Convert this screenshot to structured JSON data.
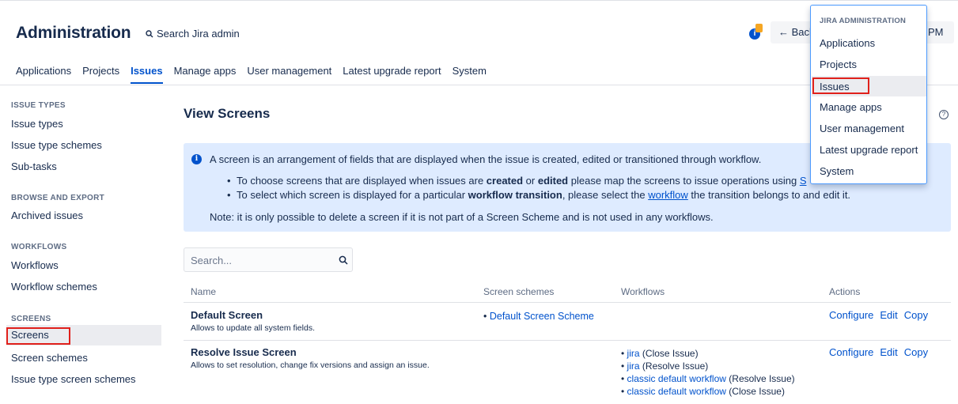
{
  "header": {
    "title": "Administration",
    "search_label": "Search Jira admin",
    "notification_glyph": "i",
    "back_label": "← Back",
    "clock_label": "PM"
  },
  "tabs": [
    "Applications",
    "Projects",
    "Issues",
    "Manage apps",
    "User management",
    "Latest upgrade report",
    "System"
  ],
  "sidebar": {
    "issue_types_heading": "ISSUE TYPES",
    "issue_types": [
      "Issue types",
      "Issue type schemes",
      "Sub-tasks"
    ],
    "browse_heading": "BROWSE AND EXPORT",
    "browse": [
      "Archived issues"
    ],
    "workflows_heading": "WORKFLOWS",
    "workflows": [
      "Workflows",
      "Workflow schemes"
    ],
    "screens_heading": "SCREENS",
    "screens": [
      "Screens",
      "Screen schemes",
      "Issue type screen schemes"
    ]
  },
  "main": {
    "title": "View Screens",
    "help_glyph": "?",
    "info": {
      "glyph": "i",
      "main": "A screen is an arrangement of fields that are displayed when the issue is created, edited or transitioned through workflow.",
      "b1_pre": "To choose screens that are displayed when issues are ",
      "b1_created": "created",
      "b1_or": " or ",
      "b1_edited": "edited",
      "b1_post": " please map the screens to issue operations using ",
      "b1_link": "S",
      "b2_pre": "To select which screen is displayed for a particular ",
      "b2_bold": "workflow transition",
      "b2_mid": ", please select the ",
      "b2_link": "workflow",
      "b2_post": " the transition belongs to and edit it.",
      "note": "Note: it is only possible to delete a screen if it is not part of a Screen Scheme and is not used in any workflows."
    },
    "search_placeholder": "Search...",
    "columns": {
      "name": "Name",
      "screen_schemes": "Screen schemes",
      "workflows": "Workflows",
      "actions": "Actions"
    },
    "rows": [
      {
        "name": "Default Screen",
        "description": "Allows to update all system fields.",
        "scheme": "Default Screen Scheme",
        "workflows": [],
        "actions": [
          "Configure",
          "Edit",
          "Copy"
        ]
      },
      {
        "name": "Resolve Issue Screen",
        "description": "Allows to set resolution, change fix versions and assign an issue.",
        "scheme": "",
        "workflows": [
          {
            "link": "jira",
            "transition": "(Close Issue)"
          },
          {
            "link": "jira",
            "transition": "(Resolve Issue)"
          },
          {
            "link": "classic default workflow",
            "transition": "(Resolve Issue)"
          },
          {
            "link": "classic default workflow",
            "transition": "(Close Issue)"
          }
        ],
        "actions": [
          "Configure",
          "Edit",
          "Copy"
        ]
      }
    ]
  },
  "dropdown": {
    "heading": "JIRA ADMINISTRATION",
    "items": [
      "Applications",
      "Projects",
      "Issues",
      "Manage apps",
      "User management",
      "Latest upgrade report",
      "System"
    ]
  },
  "colors": {
    "accent": "#0052cc",
    "highlight_box": "#e0201b",
    "info_background": "#deebff"
  }
}
